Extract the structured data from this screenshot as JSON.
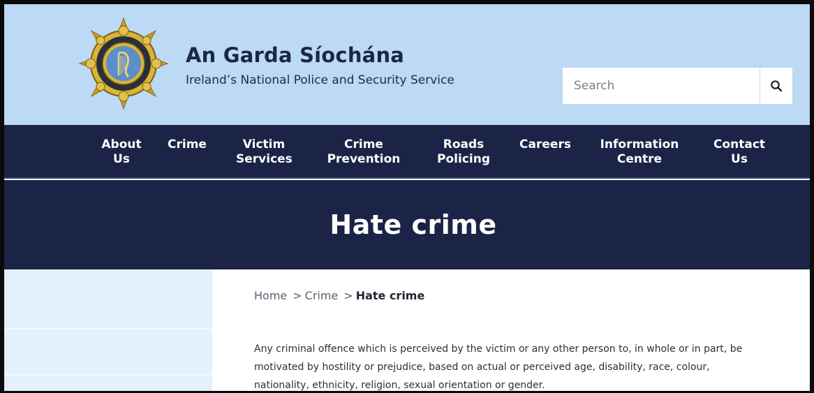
{
  "site": {
    "title": "An Garda Síochána",
    "subtitle": "Ireland’s National Police and Security Service"
  },
  "search": {
    "placeholder": "Search",
    "icon": "search-icon"
  },
  "nav": {
    "items": [
      {
        "line1": "About",
        "line2": "Us"
      },
      {
        "line1": "Crime",
        "line2": ""
      },
      {
        "line1": "Victim",
        "line2": "Services"
      },
      {
        "line1": "Crime",
        "line2": "Prevention"
      },
      {
        "line1": "Roads",
        "line2": "Policing"
      },
      {
        "line1": "Careers",
        "line2": ""
      },
      {
        "line1": "Information",
        "line2": "Centre"
      },
      {
        "line1": "Contact",
        "line2": "Us"
      }
    ]
  },
  "page": {
    "heading": "Hate crime"
  },
  "breadcrumb": {
    "home": "Home",
    "crime": "Crime",
    "current": "Hate crime",
    "separator": ">"
  },
  "content": {
    "lines": [
      "Any criminal offence which is perceived by the victim or any other person to, in whole or in part, be",
      "motivated by hostility or prejudice, based on actual or perceived age, disability, race, colour,",
      "nationality, ethnicity, religion, sexual orientation or gender."
    ]
  },
  "colors": {
    "header_bg": "#bcd9f5",
    "nav_bg": "#1b2446",
    "sidebar_bg": "#e4f0fb",
    "badge_gold": "#d9b43a",
    "badge_blue": "#5a8fc9"
  }
}
